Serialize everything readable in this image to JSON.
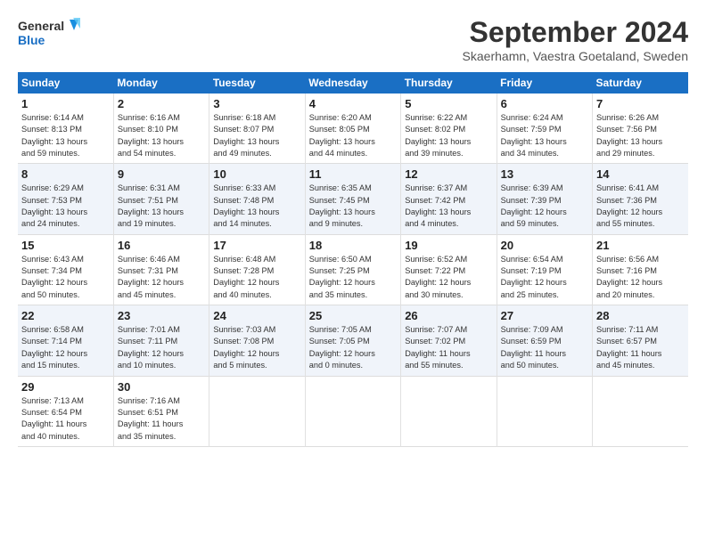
{
  "header": {
    "logo_line1": "General",
    "logo_line2": "Blue",
    "month_title": "September 2024",
    "location": "Skaerhamn, Vaestra Goetaland, Sweden"
  },
  "weekdays": [
    "Sunday",
    "Monday",
    "Tuesday",
    "Wednesday",
    "Thursday",
    "Friday",
    "Saturday"
  ],
  "weeks": [
    [
      {
        "day": "1",
        "lines": [
          "Sunrise: 6:14 AM",
          "Sunset: 8:13 PM",
          "Daylight: 13 hours",
          "and 59 minutes."
        ]
      },
      {
        "day": "2",
        "lines": [
          "Sunrise: 6:16 AM",
          "Sunset: 8:10 PM",
          "Daylight: 13 hours",
          "and 54 minutes."
        ]
      },
      {
        "day": "3",
        "lines": [
          "Sunrise: 6:18 AM",
          "Sunset: 8:07 PM",
          "Daylight: 13 hours",
          "and 49 minutes."
        ]
      },
      {
        "day": "4",
        "lines": [
          "Sunrise: 6:20 AM",
          "Sunset: 8:05 PM",
          "Daylight: 13 hours",
          "and 44 minutes."
        ]
      },
      {
        "day": "5",
        "lines": [
          "Sunrise: 6:22 AM",
          "Sunset: 8:02 PM",
          "Daylight: 13 hours",
          "and 39 minutes."
        ]
      },
      {
        "day": "6",
        "lines": [
          "Sunrise: 6:24 AM",
          "Sunset: 7:59 PM",
          "Daylight: 13 hours",
          "and 34 minutes."
        ]
      },
      {
        "day": "7",
        "lines": [
          "Sunrise: 6:26 AM",
          "Sunset: 7:56 PM",
          "Daylight: 13 hours",
          "and 29 minutes."
        ]
      }
    ],
    [
      {
        "day": "8",
        "lines": [
          "Sunrise: 6:29 AM",
          "Sunset: 7:53 PM",
          "Daylight: 13 hours",
          "and 24 minutes."
        ]
      },
      {
        "day": "9",
        "lines": [
          "Sunrise: 6:31 AM",
          "Sunset: 7:51 PM",
          "Daylight: 13 hours",
          "and 19 minutes."
        ]
      },
      {
        "day": "10",
        "lines": [
          "Sunrise: 6:33 AM",
          "Sunset: 7:48 PM",
          "Daylight: 13 hours",
          "and 14 minutes."
        ]
      },
      {
        "day": "11",
        "lines": [
          "Sunrise: 6:35 AM",
          "Sunset: 7:45 PM",
          "Daylight: 13 hours",
          "and 9 minutes."
        ]
      },
      {
        "day": "12",
        "lines": [
          "Sunrise: 6:37 AM",
          "Sunset: 7:42 PM",
          "Daylight: 13 hours",
          "and 4 minutes."
        ]
      },
      {
        "day": "13",
        "lines": [
          "Sunrise: 6:39 AM",
          "Sunset: 7:39 PM",
          "Daylight: 12 hours",
          "and 59 minutes."
        ]
      },
      {
        "day": "14",
        "lines": [
          "Sunrise: 6:41 AM",
          "Sunset: 7:36 PM",
          "Daylight: 12 hours",
          "and 55 minutes."
        ]
      }
    ],
    [
      {
        "day": "15",
        "lines": [
          "Sunrise: 6:43 AM",
          "Sunset: 7:34 PM",
          "Daylight: 12 hours",
          "and 50 minutes."
        ]
      },
      {
        "day": "16",
        "lines": [
          "Sunrise: 6:46 AM",
          "Sunset: 7:31 PM",
          "Daylight: 12 hours",
          "and 45 minutes."
        ]
      },
      {
        "day": "17",
        "lines": [
          "Sunrise: 6:48 AM",
          "Sunset: 7:28 PM",
          "Daylight: 12 hours",
          "and 40 minutes."
        ]
      },
      {
        "day": "18",
        "lines": [
          "Sunrise: 6:50 AM",
          "Sunset: 7:25 PM",
          "Daylight: 12 hours",
          "and 35 minutes."
        ]
      },
      {
        "day": "19",
        "lines": [
          "Sunrise: 6:52 AM",
          "Sunset: 7:22 PM",
          "Daylight: 12 hours",
          "and 30 minutes."
        ]
      },
      {
        "day": "20",
        "lines": [
          "Sunrise: 6:54 AM",
          "Sunset: 7:19 PM",
          "Daylight: 12 hours",
          "and 25 minutes."
        ]
      },
      {
        "day": "21",
        "lines": [
          "Sunrise: 6:56 AM",
          "Sunset: 7:16 PM",
          "Daylight: 12 hours",
          "and 20 minutes."
        ]
      }
    ],
    [
      {
        "day": "22",
        "lines": [
          "Sunrise: 6:58 AM",
          "Sunset: 7:14 PM",
          "Daylight: 12 hours",
          "and 15 minutes."
        ]
      },
      {
        "day": "23",
        "lines": [
          "Sunrise: 7:01 AM",
          "Sunset: 7:11 PM",
          "Daylight: 12 hours",
          "and 10 minutes."
        ]
      },
      {
        "day": "24",
        "lines": [
          "Sunrise: 7:03 AM",
          "Sunset: 7:08 PM",
          "Daylight: 12 hours",
          "and 5 minutes."
        ]
      },
      {
        "day": "25",
        "lines": [
          "Sunrise: 7:05 AM",
          "Sunset: 7:05 PM",
          "Daylight: 12 hours",
          "and 0 minutes."
        ]
      },
      {
        "day": "26",
        "lines": [
          "Sunrise: 7:07 AM",
          "Sunset: 7:02 PM",
          "Daylight: 11 hours",
          "and 55 minutes."
        ]
      },
      {
        "day": "27",
        "lines": [
          "Sunrise: 7:09 AM",
          "Sunset: 6:59 PM",
          "Daylight: 11 hours",
          "and 50 minutes."
        ]
      },
      {
        "day": "28",
        "lines": [
          "Sunrise: 7:11 AM",
          "Sunset: 6:57 PM",
          "Daylight: 11 hours",
          "and 45 minutes."
        ]
      }
    ],
    [
      {
        "day": "29",
        "lines": [
          "Sunrise: 7:13 AM",
          "Sunset: 6:54 PM",
          "Daylight: 11 hours",
          "and 40 minutes."
        ]
      },
      {
        "day": "30",
        "lines": [
          "Sunrise: 7:16 AM",
          "Sunset: 6:51 PM",
          "Daylight: 11 hours",
          "and 35 minutes."
        ]
      },
      {
        "day": "",
        "lines": []
      },
      {
        "day": "",
        "lines": []
      },
      {
        "day": "",
        "lines": []
      },
      {
        "day": "",
        "lines": []
      },
      {
        "day": "",
        "lines": []
      }
    ]
  ]
}
